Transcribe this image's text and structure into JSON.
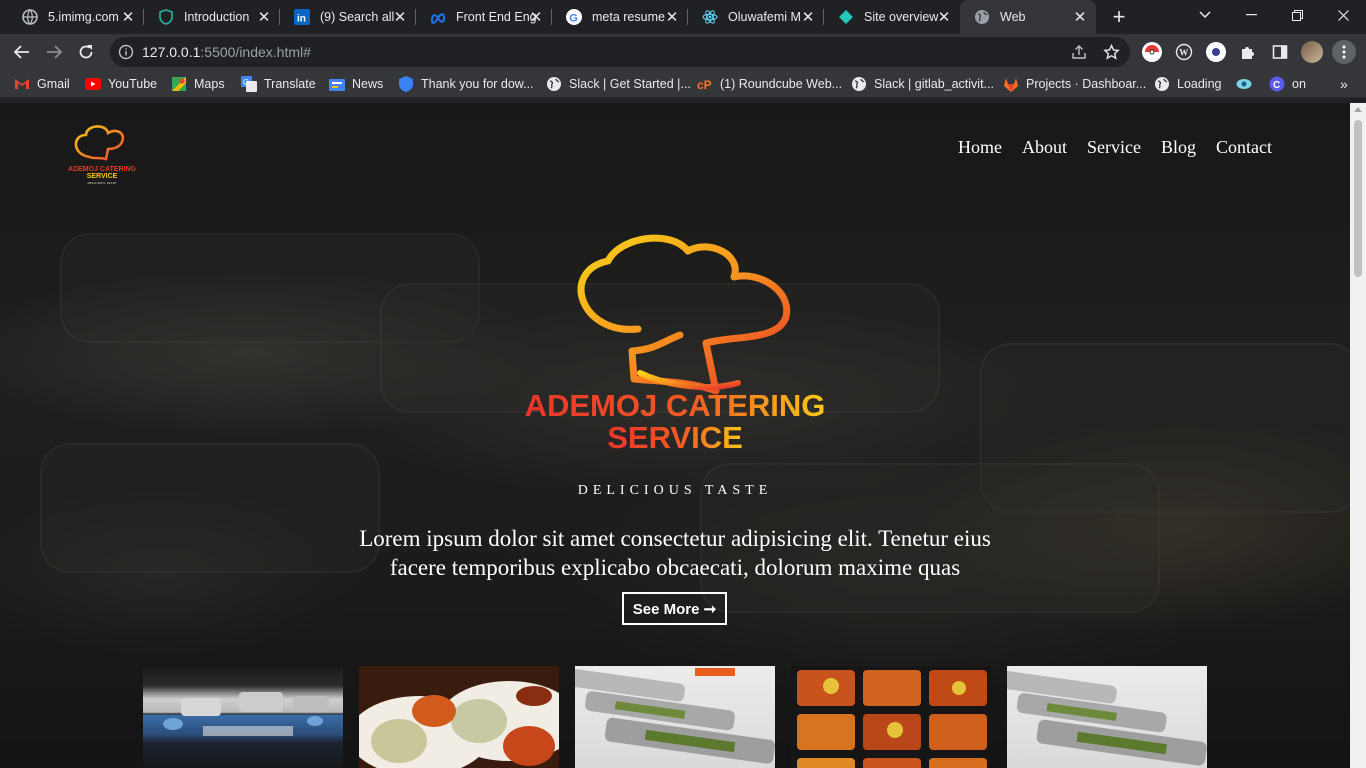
{
  "browser": {
    "tabs": [
      {
        "title": "5.imimg.com",
        "icon": "globe-icon"
      },
      {
        "title": "Introduction",
        "icon": "shield-icon"
      },
      {
        "title": "(9) Search all",
        "icon": "linkedin-icon"
      },
      {
        "title": "Front End Eng",
        "icon": "meta-icon"
      },
      {
        "title": "meta resume",
        "icon": "google-icon"
      },
      {
        "title": "Oluwafemi M",
        "icon": "react-icon"
      },
      {
        "title": "Site overview",
        "icon": "netlify-icon"
      },
      {
        "title": "Web",
        "icon": "globe-icon",
        "active": true
      }
    ],
    "url_host": "127.0.0.1",
    "url_rest": ":5500/index.html#",
    "bookmarks": [
      {
        "label": "Gmail",
        "icon": "gmail-icon"
      },
      {
        "label": "YouTube",
        "icon": "youtube-icon"
      },
      {
        "label": "Maps",
        "icon": "maps-icon"
      },
      {
        "label": "Translate",
        "icon": "translate-icon"
      },
      {
        "label": "News",
        "icon": "news-icon"
      },
      {
        "label": "Thank you for dow...",
        "icon": "shield-blue-icon"
      },
      {
        "label": "Slack | Get Started |...",
        "icon": "globe-icon"
      },
      {
        "label": "(1) Roundcube Web...",
        "icon": "cpanel-icon"
      },
      {
        "label": "Slack | gitlab_activit...",
        "icon": "globe-icon"
      },
      {
        "label": "Projects · Dashboar...",
        "icon": "gitlab-icon"
      },
      {
        "label": "Loading",
        "icon": "globe-icon"
      },
      {
        "label": "",
        "icon": "eye-icon"
      },
      {
        "label": "on",
        "icon": "c-icon"
      }
    ]
  },
  "site": {
    "nav": [
      "Home",
      "About",
      "Service",
      "Blog",
      "Contact"
    ],
    "brand_line1": "ADEMOJ CATERING",
    "brand_line2": "SERVICE",
    "tagline": "DELICIOUS TASTE",
    "lede": "Lorem ipsum dolor sit amet consectetur adipisicing elit. Tenetur eius facere temporibus explicabo obcaecati, dolorum maxime quas",
    "see_more": "See More ➞",
    "colors": {
      "brand_red": "#e8352a",
      "brand_orange": "#f7931e",
      "brand_yellow": "#f9c81a"
    },
    "gallery": [
      "buffet-table-photo",
      "jollof-rice-plates-photo",
      "chafing-dishes-photo",
      "food-packs-photo",
      "chafing-dishes-row-photo"
    ]
  }
}
